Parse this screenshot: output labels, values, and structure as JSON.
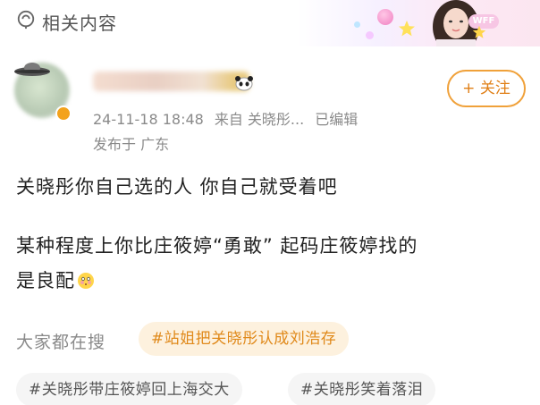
{
  "header": {
    "title": "相关内容",
    "icon": "location-tag-icon",
    "banner_badge": "WFF",
    "accent_color": "#f07fc1"
  },
  "post": {
    "author_avatar_icon": "ufo-avatar-icon",
    "verify_icon": "verified-badge-icon",
    "follow_label": "+ 关注",
    "time": "24-11-18 18:48",
    "source": "来自 关晓彤...",
    "edited": "已编辑",
    "location": "发布于 广东",
    "text_line1": "关晓彤你自己选的人 你自己就受着吧",
    "text_line2": "某种程度上你比庄筱婷“勇敢” 起码庄筱婷找的",
    "text_line3": "是良配",
    "accent_color": "#f0a13a"
  },
  "related_search": {
    "label": "大家都在搜",
    "chips": [
      "#站姐把关晓彤认成刘浩存",
      "#关晓彤带庄筱婷回上海交大",
      "#关晓彤笑着落泪"
    ]
  }
}
